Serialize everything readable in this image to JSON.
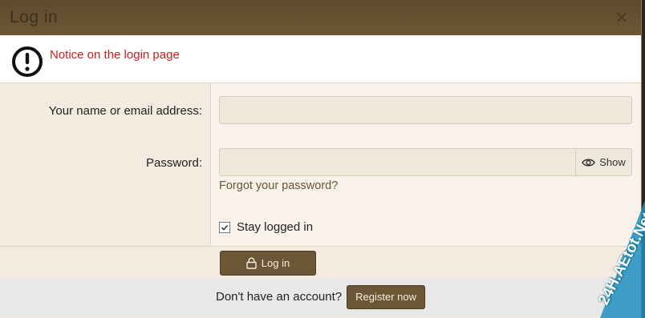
{
  "dialog": {
    "title": "Log in",
    "close_icon": "close-icon"
  },
  "notice": {
    "icon": "exclamation-circle-icon",
    "text": "Notice on the login page"
  },
  "form": {
    "name_label": "Your name or email address:",
    "name_value": "",
    "password_label": "Password:",
    "password_value": "",
    "show_label": "Show",
    "show_icon": "eye-icon",
    "forgot_label": "Forgot your password?",
    "stay_logged_in_label": "Stay logged in",
    "stay_logged_in_checked": true,
    "login_label": "Log in",
    "login_icon": "lock-icon"
  },
  "footer": {
    "prompt": "Don't have an account?",
    "register_label": "Register now"
  },
  "watermark": {
    "text": "24H.AEtot.Net"
  },
  "colors": {
    "header": "#5e4a2c",
    "button": "#6d5635",
    "notice": "#c62020",
    "link": "#6b5433"
  }
}
